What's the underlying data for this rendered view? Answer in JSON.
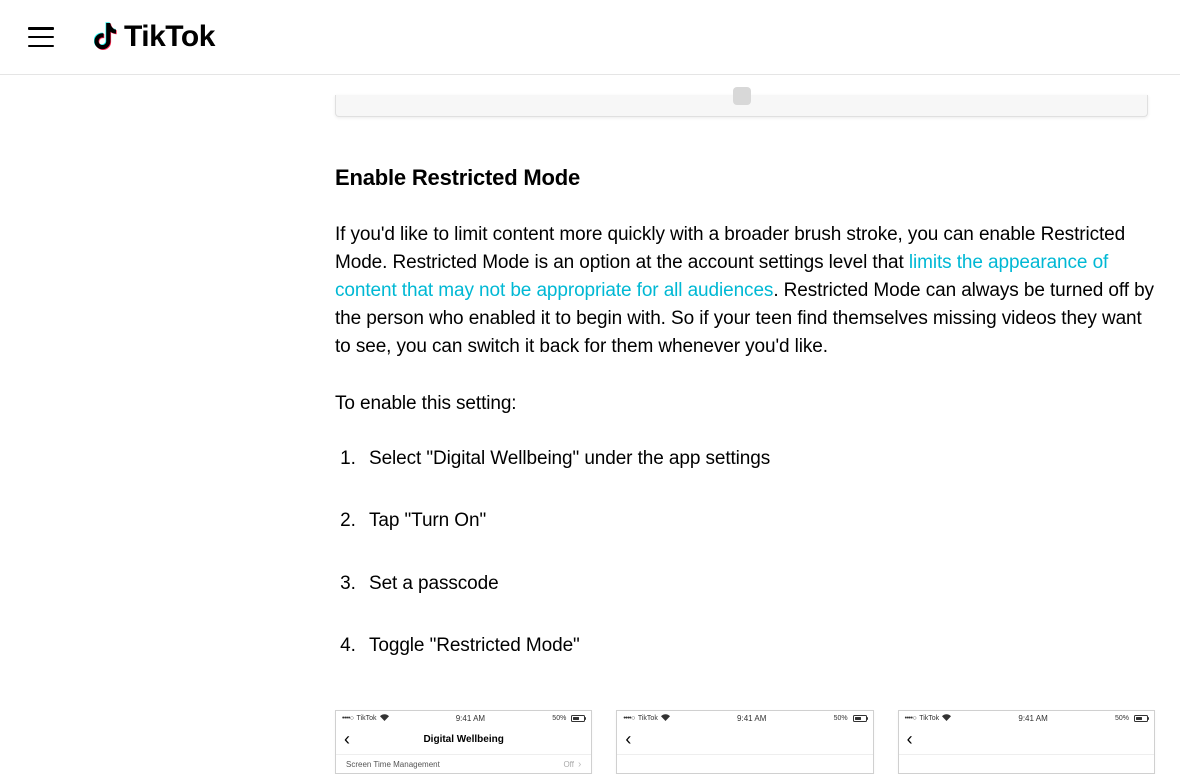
{
  "header": {
    "brand": "TikTok"
  },
  "article": {
    "heading": "Enable Restricted Mode",
    "para1_a": "If you'd like to limit content more quickly with a broader brush stroke, you can enable Restricted Mode. Restricted Mode is an option at the account settings level that ",
    "link_text": "limits the appearance of content that may not be appropriate for all audiences",
    "para1_b": ". Restricted Mode can always be turned off by the person who enabled it to begin with. So if your teen find themselves missing videos they want to see, you can switch it back for them whenever you'd like.",
    "para2": "To enable this setting:",
    "steps": [
      "Select \"Digital Wellbeing\" under the app settings",
      "Tap \"Turn On\"",
      "Set a passcode",
      "Toggle \"Restricted Mode\""
    ]
  },
  "phones": {
    "status_carrier": "••••○ TikTok",
    "status_dots": "••••○",
    "status_carrier_name": "TikTok",
    "status_time": "9:41 AM",
    "status_battery": "50%",
    "screen1_title": "Digital Wellbeing",
    "screen1_row_label": "Screen Time Management",
    "screen1_row_value": "Off"
  }
}
